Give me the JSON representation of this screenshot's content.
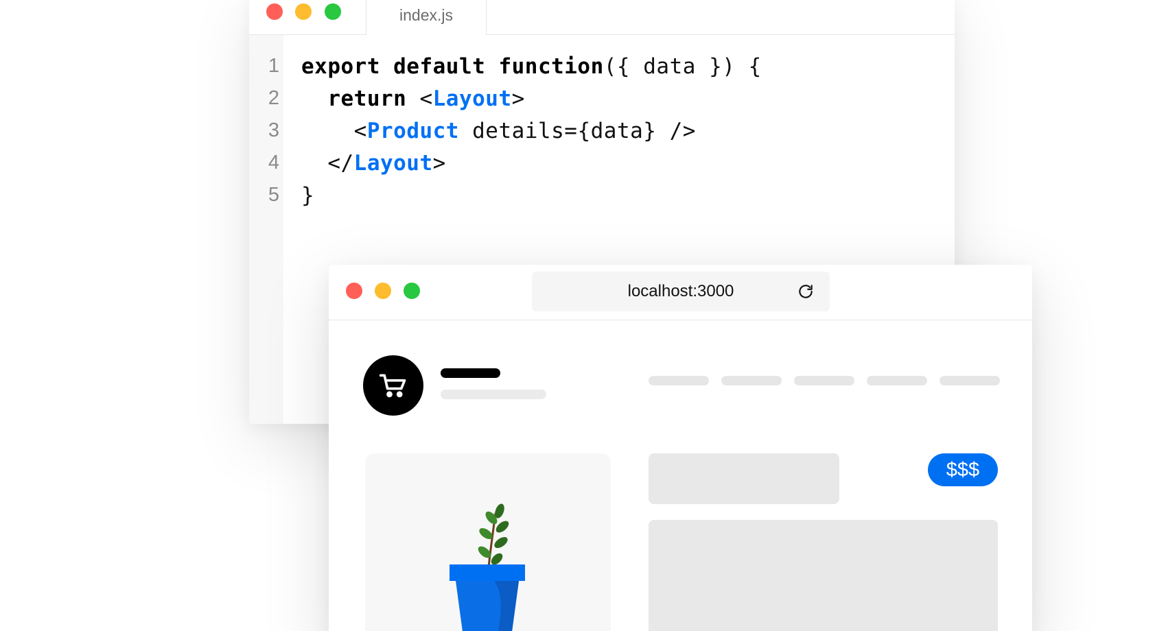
{
  "editor": {
    "tab_label": "index.js",
    "line_numbers": [
      "1",
      "2",
      "3",
      "4",
      "5"
    ],
    "code": {
      "line1": {
        "kw": "export default function",
        "rest": "({ data }) {"
      },
      "line2": {
        "indent": "  ",
        "kw": "return",
        "open": " <",
        "component": "Layout",
        "close": ">"
      },
      "line3": {
        "indent": "    ",
        "open": "<",
        "component": "Product",
        "rest": " details={data} />"
      },
      "line4": {
        "indent": "  ",
        "open": "</",
        "component": "Layout",
        "close": ">"
      },
      "line5": {
        "text": "}"
      }
    }
  },
  "browser": {
    "address": "localhost:3000",
    "reload_icon": "reload-icon",
    "logo_icon": "shopping-cart-icon",
    "price_badge": "$$$",
    "product_image_icon": "potted-plant-icon"
  },
  "colors": {
    "accent": "#0070f3",
    "window_red": "#ff5f57",
    "window_yellow": "#febc2e",
    "window_green": "#28c840",
    "skeleton": "#e8e8e8"
  }
}
